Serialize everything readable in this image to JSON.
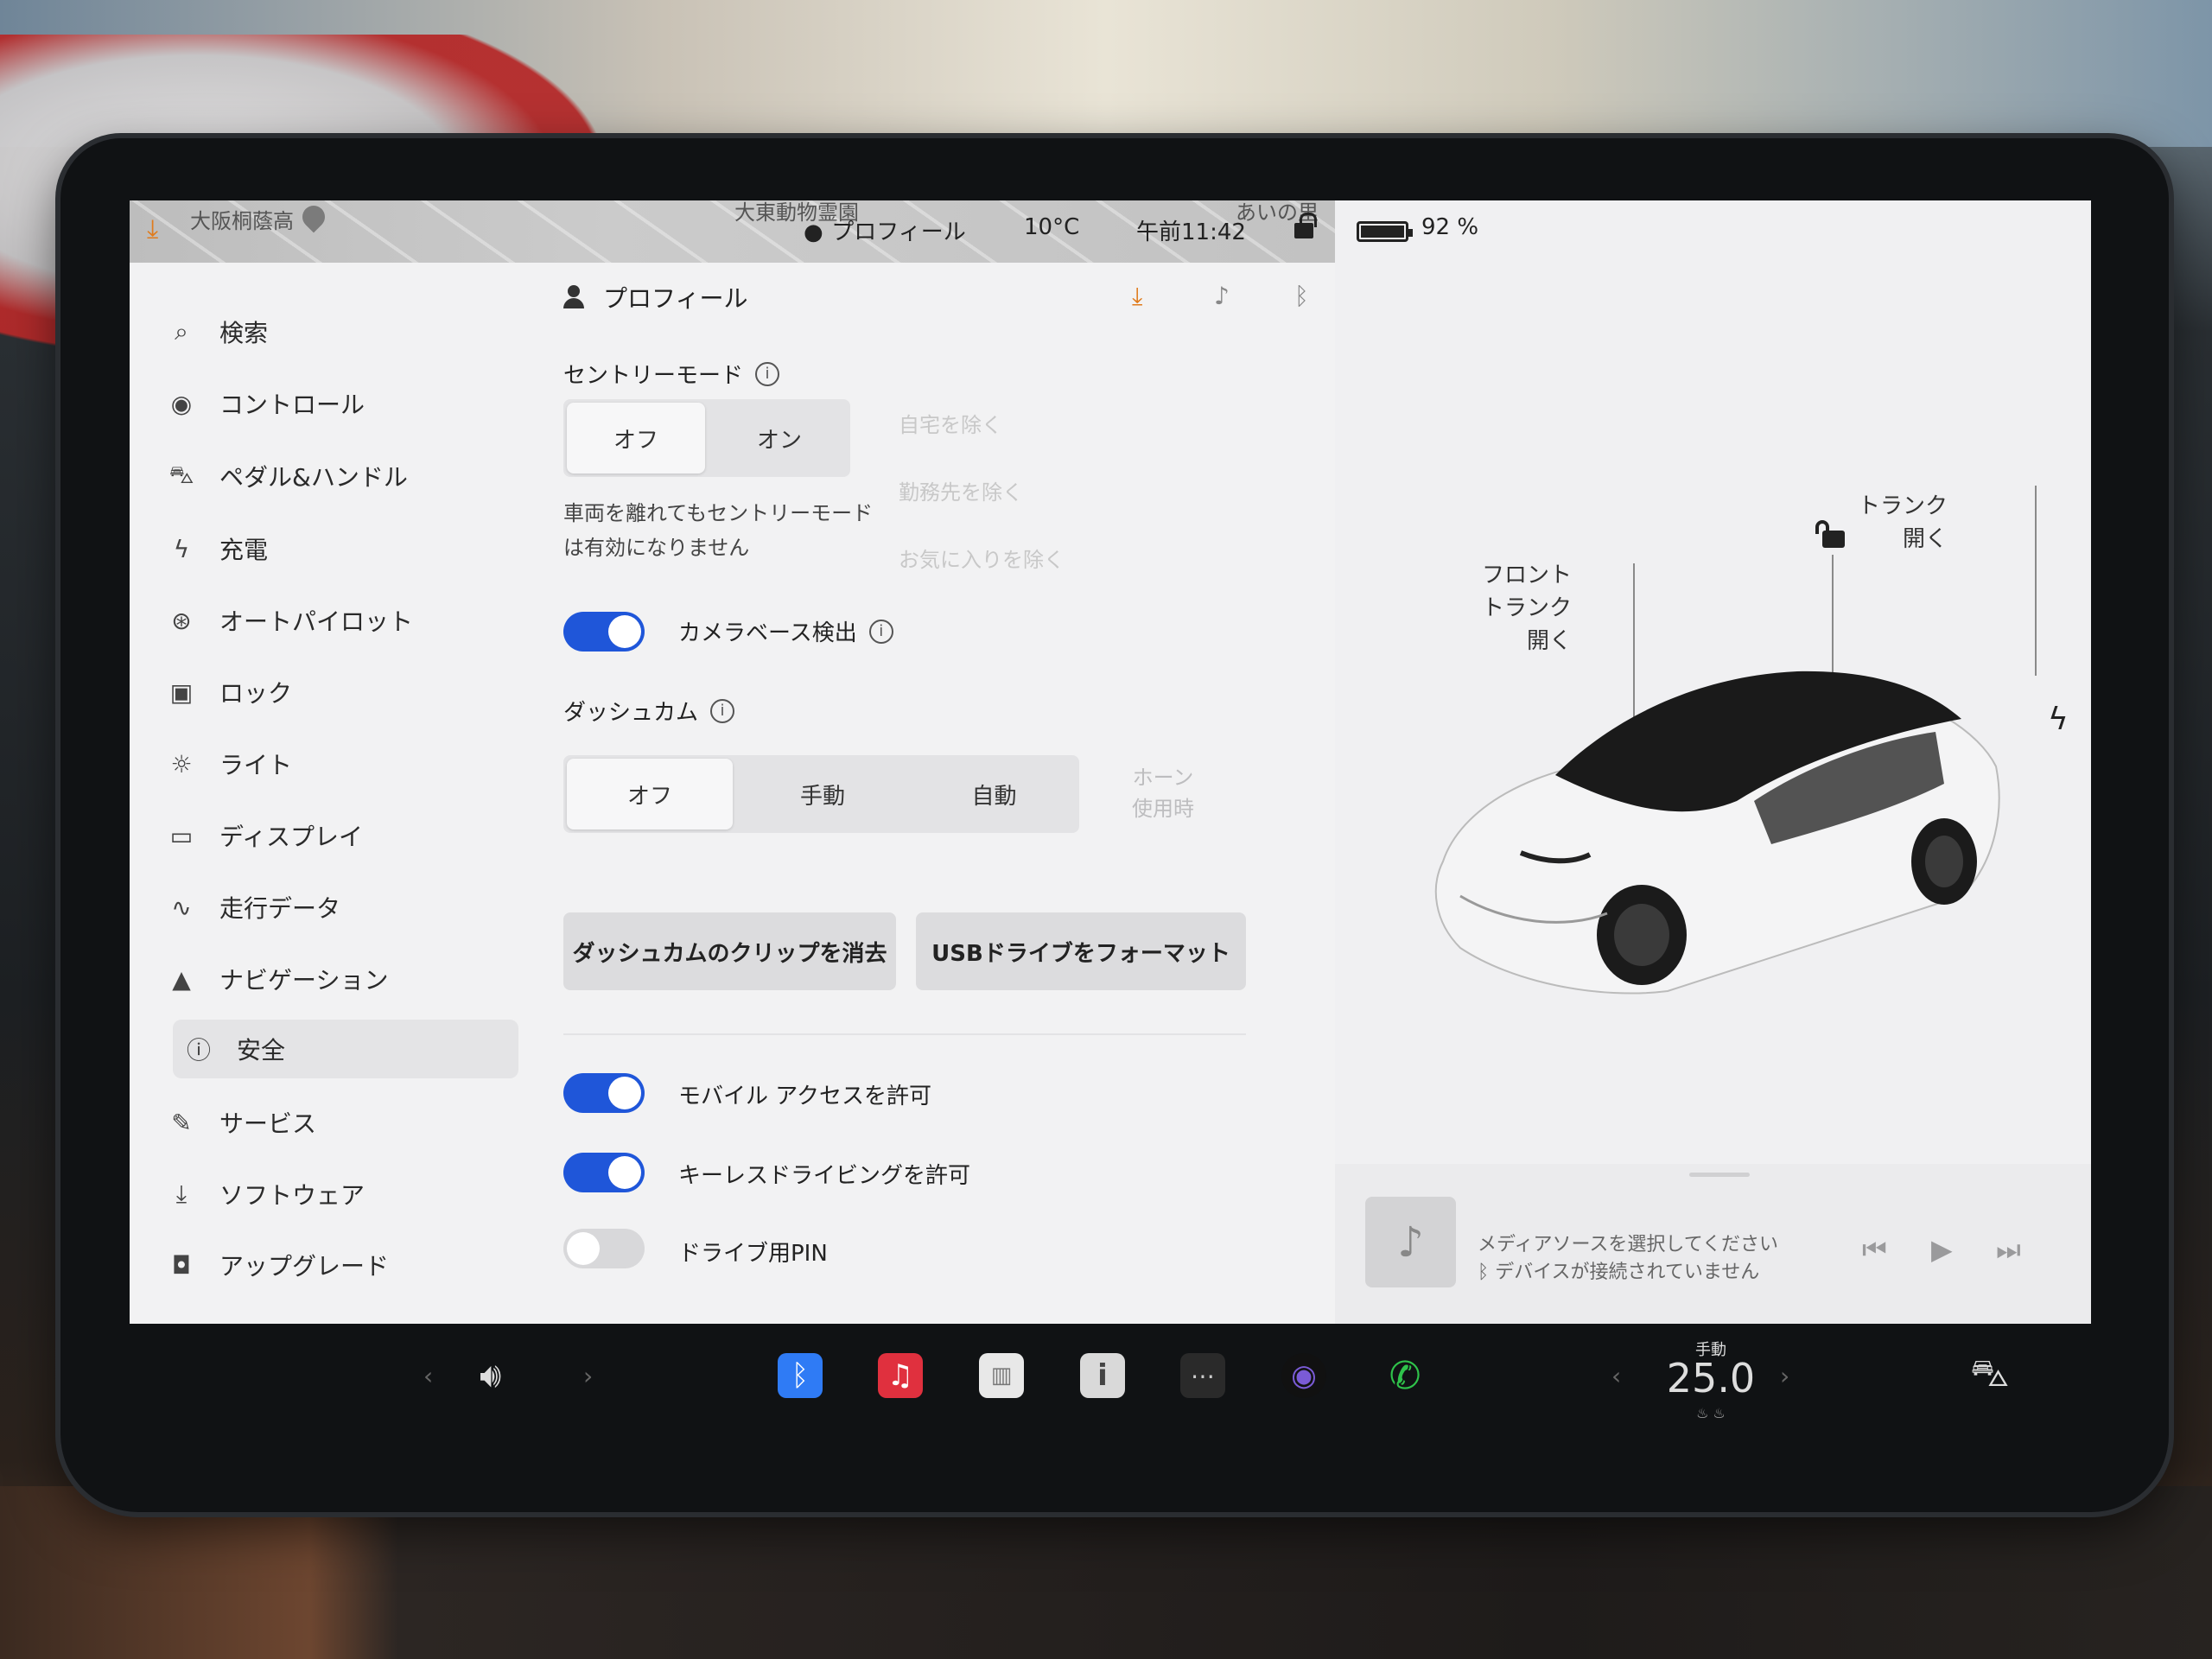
{
  "map": {
    "place1": "大阪桐蔭高",
    "place2": "大東動物霊園",
    "place3": "あいの里"
  },
  "status": {
    "profile": "プロフィール",
    "temperature": "10°C",
    "time": "午前11:42",
    "battery": "92 %"
  },
  "sidebar": {
    "items": [
      {
        "label": "検索",
        "icon": "search-icon"
      },
      {
        "label": "コントロール",
        "icon": "toggle-icon"
      },
      {
        "label": "ペダル&ハンドル",
        "icon": "car-icon"
      },
      {
        "label": "充電",
        "icon": "bolt-icon"
      },
      {
        "label": "オートパイロット",
        "icon": "steering-wheel-icon"
      },
      {
        "label": "ロック",
        "icon": "lock-icon"
      },
      {
        "label": "ライト",
        "icon": "sun-icon"
      },
      {
        "label": "ディスプレイ",
        "icon": "display-icon"
      },
      {
        "label": "走行データ",
        "icon": "trip-icon"
      },
      {
        "label": "ナビゲーション",
        "icon": "navigation-icon"
      },
      {
        "label": "安全",
        "icon": "alert-circle-icon"
      },
      {
        "label": "サービス",
        "icon": "wrench-icon"
      },
      {
        "label": "ソフトウェア",
        "icon": "download-icon"
      },
      {
        "label": "アップグレード",
        "icon": "bag-icon"
      }
    ],
    "active_index": 10
  },
  "panel": {
    "profile_label": "プロフィール",
    "sentry": {
      "title": "セントリーモード",
      "options": [
        "オフ",
        "オン"
      ],
      "selected": "オフ",
      "desc": "車両を離れてもセントリーモードは有効になりません",
      "faded_options": [
        "自宅を除く",
        "勤務先を除く",
        "お気に入りを除く"
      ]
    },
    "camera_detect": {
      "label": "カメラベース検出",
      "on": true
    },
    "dashcam": {
      "title": "ダッシュカム",
      "options": [
        "オフ",
        "手動",
        "自動"
      ],
      "selected": "オフ",
      "faded_option_line1": "ホーン",
      "faded_option_line2": "使用時"
    },
    "buttons": {
      "delete_clips": "ダッシュカムのクリップを消去",
      "format_usb": "USBドライブをフォーマット"
    },
    "mobile_access": {
      "label": "モバイル アクセスを許可",
      "on": true
    },
    "keyless": {
      "label": "キーレスドライビングを許可",
      "on": true
    },
    "drive_pin": {
      "label": "ドライブ用PIN",
      "on": false
    }
  },
  "car": {
    "front_trunk_line1": "フロント",
    "front_trunk_line2": "トランク",
    "front_trunk_line3": "開く",
    "trunk_line1": "トランク",
    "trunk_line2": "開く"
  },
  "media": {
    "line1": "メディアソースを選択してください",
    "line2": "デバイスが接続されていません"
  },
  "dock": {
    "temp_mode": "手動",
    "temp_value": "25.0",
    "colors": {
      "bluetooth": "#2f7bf5",
      "music": "#e0303e",
      "phone": "#2fc34b",
      "toggle_blue": "#1f56d9",
      "accent_orange": "#e07b1c"
    }
  }
}
